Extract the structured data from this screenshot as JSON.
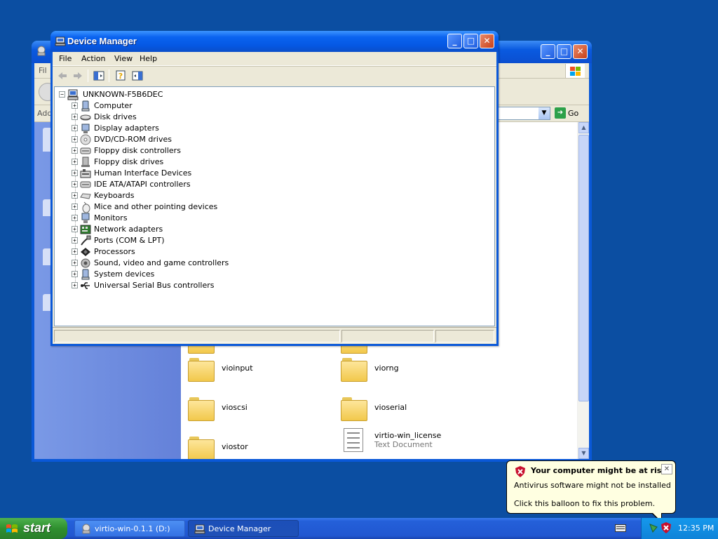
{
  "device_manager": {
    "title": "Device Manager",
    "menu": [
      "File",
      "Action",
      "View",
      "Help"
    ],
    "root": "UNKNOWN-F5B6DEC",
    "categories": [
      {
        "label": "Computer",
        "icon": "computer-icon"
      },
      {
        "label": "Disk drives",
        "icon": "disk-drive-icon"
      },
      {
        "label": "Display adapters",
        "icon": "display-adapter-icon"
      },
      {
        "label": "DVD/CD-ROM drives",
        "icon": "cdrom-icon"
      },
      {
        "label": "Floppy disk controllers",
        "icon": "controller-icon"
      },
      {
        "label": "Floppy disk drives",
        "icon": "floppy-drive-icon"
      },
      {
        "label": "Human Interface Devices",
        "icon": "hid-icon"
      },
      {
        "label": "IDE ATA/ATAPI controllers",
        "icon": "controller-icon"
      },
      {
        "label": "Keyboards",
        "icon": "keyboard-icon"
      },
      {
        "label": "Mice and other pointing devices",
        "icon": "mouse-icon"
      },
      {
        "label": "Monitors",
        "icon": "monitor-icon"
      },
      {
        "label": "Network adapters",
        "icon": "network-adapter-icon"
      },
      {
        "label": "Ports (COM & LPT)",
        "icon": "port-icon"
      },
      {
        "label": "Processors",
        "icon": "processor-icon"
      },
      {
        "label": "Sound, video and game controllers",
        "icon": "sound-icon"
      },
      {
        "label": "System devices",
        "icon": "system-device-icon"
      },
      {
        "label": "Universal Serial Bus controllers",
        "icon": "usb-icon"
      }
    ]
  },
  "explorer": {
    "menu_partial": "Fil",
    "address_partial": "Add",
    "go_label": "Go",
    "files": [
      {
        "name": "vioinput",
        "type": "folder"
      },
      {
        "name": "viorng",
        "type": "folder"
      },
      {
        "name": "vioscsi",
        "type": "folder"
      },
      {
        "name": "vioserial",
        "type": "folder"
      },
      {
        "name": "viostor",
        "type": "folder"
      },
      {
        "name": "virtio-win_license",
        "type": "Text Document"
      }
    ]
  },
  "balloon": {
    "title": "Your computer might be at risk",
    "line1": "Antivirus software might not be installed",
    "line2": "Click this balloon to fix this problem."
  },
  "taskbar": {
    "start_label": "start",
    "tasks": [
      "virtio-win-0.1.1 (D:)",
      "Device Manager"
    ],
    "clock": "12:35 PM"
  },
  "colors": {
    "desktop": "#0b4ea2",
    "titlebar": "#0a58d8",
    "window_face": "#ece9d8",
    "balloon": "#ffffe1"
  }
}
